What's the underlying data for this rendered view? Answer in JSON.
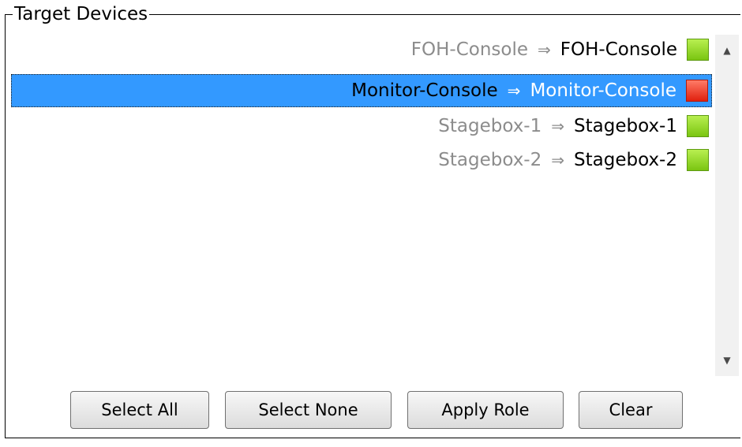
{
  "group": {
    "title": "Target Devices"
  },
  "devices": [
    {
      "source": "FOH-Console",
      "arrow": "⇒",
      "target": "FOH-Console",
      "status": "ok",
      "selected": false
    },
    {
      "source": "Monitor-Console",
      "arrow": "⇒",
      "target": "Monitor-Console",
      "status": "error",
      "selected": true
    },
    {
      "source": "Stagebox-1",
      "arrow": "⇒",
      "target": "Stagebox-1",
      "status": "ok",
      "selected": false
    },
    {
      "source": "Stagebox-2",
      "arrow": "⇒",
      "target": "Stagebox-2",
      "status": "ok",
      "selected": false
    }
  ],
  "scrollbar": {
    "up_icon": "▲",
    "down_icon": "▼"
  },
  "buttons": {
    "select_all": "Select All",
    "select_none": "Select None",
    "apply_role": "Apply Role",
    "clear": "Clear"
  },
  "colors": {
    "selection": "#3399ff",
    "status_ok": "#8ed82a",
    "status_error": "#e8301c"
  }
}
